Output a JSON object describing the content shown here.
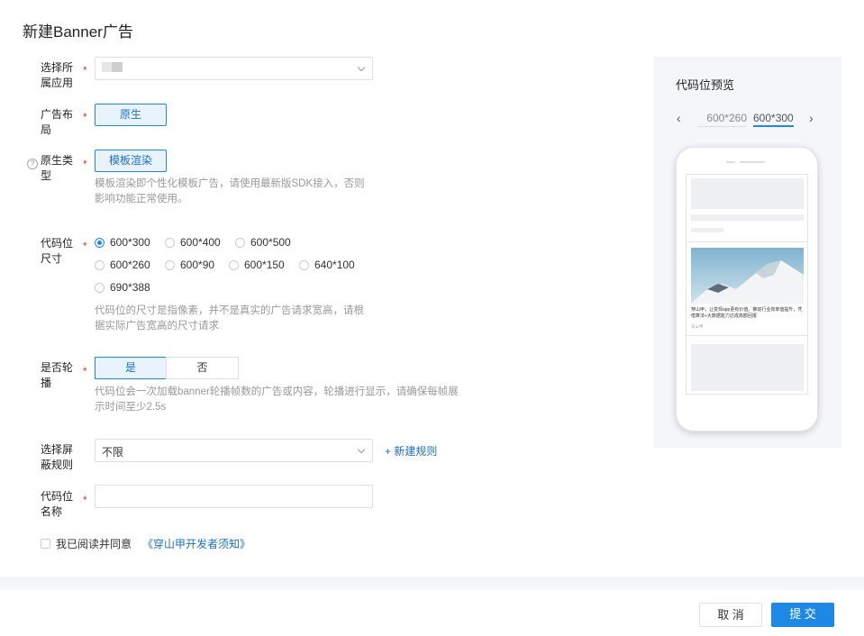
{
  "title": "新建Banner广告",
  "fields": {
    "app": {
      "label": "选择所属应用",
      "value": ""
    },
    "layout": {
      "label": "广告布局",
      "option": "原生"
    },
    "native_type": {
      "label": "原生类型",
      "option": "模板渲染",
      "hint": "模板渲染即个性化模板广告，请使用最新版SDK接入，否则影响功能正常使用。"
    },
    "size": {
      "label": "代码位尺寸",
      "options": [
        "600*300",
        "600*400",
        "600*500",
        "600*260",
        "600*90",
        "600*150",
        "640*100",
        "690*388"
      ],
      "selected": "600*300",
      "hint": "代码位的尺寸是指像素，并不是真实的广告请求宽高，请根据实际广告宽高的尺寸请求"
    },
    "carousel": {
      "label": "是否轮播",
      "yes": "是",
      "no": "否",
      "selected": "是",
      "hint": "代码位会一次加载banner轮播帧数的广告或内容，轮播进行显示，请确保每帧展示时间至少2.5s"
    },
    "block_rule": {
      "label": "选择屏蔽规则",
      "value": "不限",
      "add_link": "+ 新建规则"
    },
    "slot_name": {
      "label": "代码位名称",
      "value": ""
    },
    "agree": {
      "text": "我已阅读并同意",
      "link": "《穿山甲开发者须知》",
      "checked": false
    }
  },
  "preview": {
    "title": "代码位预览",
    "tabs": [
      "600*260",
      "600*300"
    ],
    "active_tab": "600*300",
    "ad_text": "穿山甲，让变现app更有价值。推动行业效率值提升，凭借算法+大数据能力达成高额回报",
    "ad_source": "穿山甲"
  },
  "buttons": {
    "cancel": "取 消",
    "submit": "提 交"
  },
  "colors": {
    "accent": "#1e88e5",
    "required": "#e0322f"
  }
}
